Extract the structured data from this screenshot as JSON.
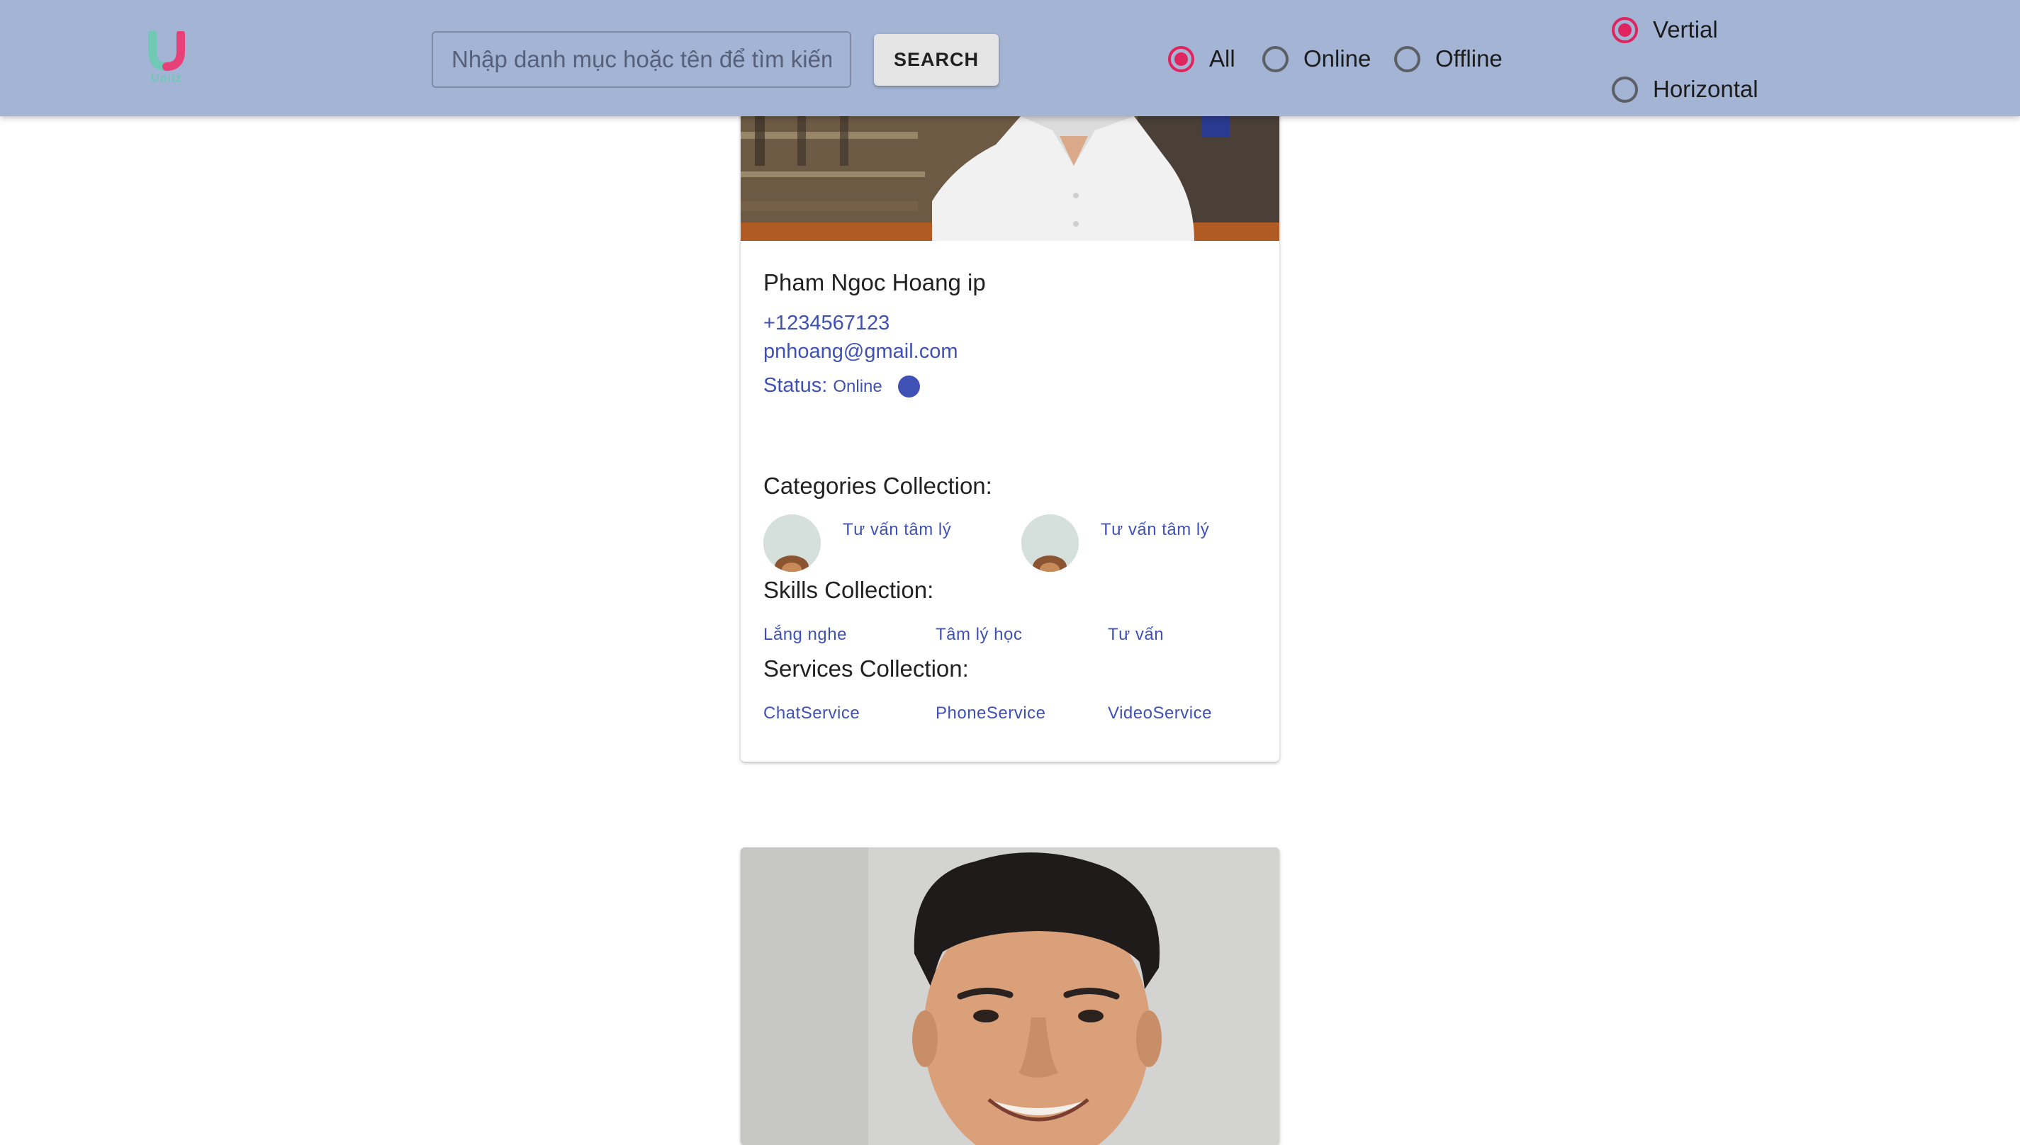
{
  "header": {
    "logo_text": "Unitz",
    "search": {
      "placeholder": "Nhập danh mục hoặc tên để tìm kiếm",
      "value": ""
    },
    "search_button": "SEARCH",
    "filter_options": [
      "All",
      "Online",
      "Offline"
    ],
    "filter_selected": "All",
    "layout_options": [
      "Vertial",
      "Horizontal"
    ],
    "layout_selected": "Vertial"
  },
  "cards": [
    {
      "name": "Pham Ngoc Hoang ip",
      "phone": "+1234567123",
      "email": "pnhoang@gmail.com",
      "status_label": "Status:",
      "status_value": "Online",
      "categories_title": "Categories Collection:",
      "categories": [
        "Tư vấn tâm lý",
        "Tư vấn tâm lý"
      ],
      "skills_title": "Skills Collection:",
      "skills": [
        "Lắng nghe",
        "Tâm lý học",
        "Tư vấn"
      ],
      "services_title": "Services Collection:",
      "services": [
        "ChatService",
        "PhoneService",
        "VideoService"
      ]
    }
  ],
  "colors": {
    "header_bg": "#a3b4d4",
    "accent": "#e0245e",
    "link": "#3f51b5",
    "status_online": "#3f51b5"
  }
}
